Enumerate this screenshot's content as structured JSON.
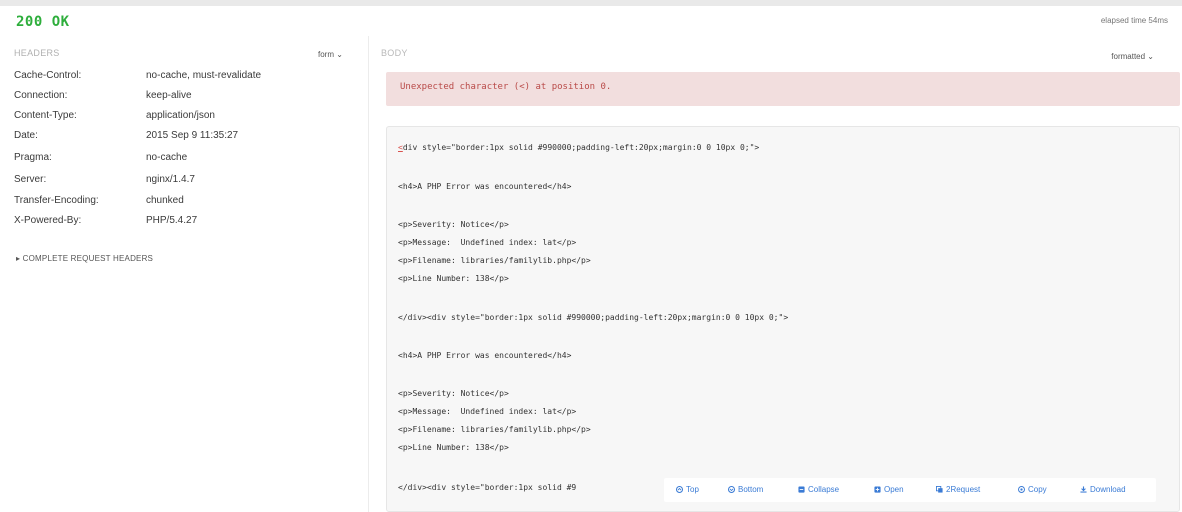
{
  "status": {
    "text": "200 OK",
    "color": "#2eae3c"
  },
  "elapsed": "elapsed time 54ms",
  "headers": {
    "title": "HEADERS",
    "format_select": "form ⌄",
    "rows": [
      {
        "key": "Cache-Control:",
        "value": "no-cache, must-revalidate"
      },
      {
        "key": "Connection:",
        "value": "keep-alive"
      },
      {
        "key": "Content-Type:",
        "value": "application/json"
      },
      {
        "key": "Date:",
        "value": "2015 Sep 9 11:35:27"
      },
      {
        "key": "Pragma:",
        "value": "no-cache"
      },
      {
        "key": "Server:",
        "value": "nginx/1.4.7"
      },
      {
        "key": "Transfer-Encoding:",
        "value": "chunked"
      },
      {
        "key": "X-Powered-By:",
        "value": "PHP/5.4.27"
      }
    ],
    "complete_request": "▸ COMPLETE REQUEST HEADERS"
  },
  "body": {
    "title": "BODY",
    "formatted_select": "formatted ⌄",
    "error": "Unexpected character (<) at position 0.",
    "code_first_char": "<",
    "code_lines": [
      "div style=\"border:1px solid #990000;padding-left:20px;margin:0 0 10px 0;\">",
      "<h4>A PHP Error was encountered</h4>",
      "<p>Severity: Notice</p>",
      "<p>Message:  Undefined index: lat</p>",
      "<p>Filename: libraries/familylib.php</p>",
      "<p>Line Number: 138</p>",
      "</div><div style=\"border:1px solid #990000;padding-left:20px;margin:0 0 10px 0;\">",
      "<h4>A PHP Error was encountered</h4>",
      "<p>Severity: Notice</p>",
      "<p>Message:  Undefined index: lat</p>",
      "<p>Filename: libraries/familylib.php</p>",
      "<p>Line Number: 138</p>",
      "</div><div style=\"border:1px solid #9"
    ]
  },
  "toolbar": {
    "accent": "#3a7bd5",
    "buttons": [
      {
        "label": "Top",
        "icon": "circle-up-icon"
      },
      {
        "label": "Bottom",
        "icon": "circle-down-icon"
      },
      {
        "label": "Collapse",
        "icon": "collapse-icon"
      },
      {
        "label": "Open",
        "icon": "open-icon"
      },
      {
        "label": "2Request",
        "icon": "copy-to-request-icon"
      },
      {
        "label": "Copy",
        "icon": "copy-icon"
      },
      {
        "label": "Download",
        "icon": "download-icon"
      }
    ]
  }
}
